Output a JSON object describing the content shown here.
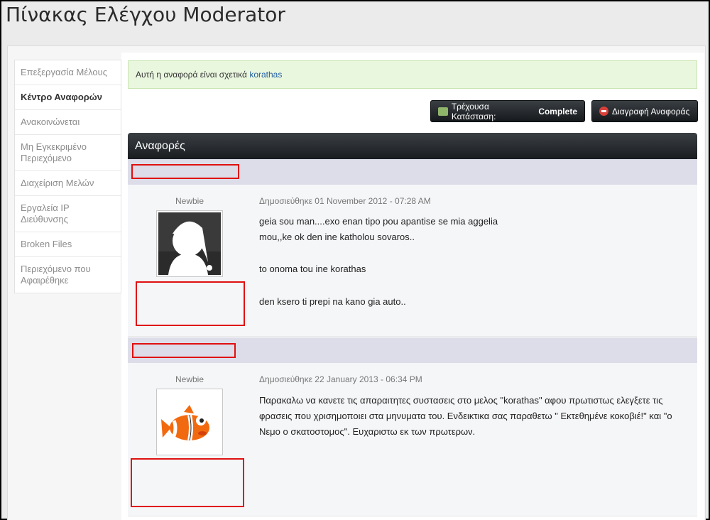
{
  "page": {
    "title": "Πίνακας Ελέγχου Moderator"
  },
  "sidebar": {
    "items": [
      {
        "label": "Επεξεργασία Μέλους"
      },
      {
        "label": "Κέντρο Αναφορών"
      },
      {
        "label": "Ανακοινώνεται"
      },
      {
        "label": "Μη Εγκεκριμένο Περιεχόμενο"
      },
      {
        "label": "Διαχείριση Μελών"
      },
      {
        "label": "Εργαλεία IP Διεύθυνσης"
      },
      {
        "label": "Broken Files"
      },
      {
        "label": "Περιεχόμενο που Αφαιρέθηκε"
      }
    ],
    "active_index": 1
  },
  "notice": {
    "text": "Αυτή η αναφορά είναι σχετικά",
    "link": "korathas"
  },
  "actions": {
    "status_prefix": "Τρέχουσα Κατάσταση:",
    "status_value": "Complete",
    "delete_label": "Διαγραφή Αναφοράς"
  },
  "section": {
    "title": "Αναφορές"
  },
  "posts": [
    {
      "user_title": "Newbie",
      "date": "Δημοσιεύθηκε 01 November 2012 - 07:28 AM",
      "lines": [
        "geia sou man....exo enan tipo pou apantise se mia aggelia mou,,ke ok den ine katholou sovaros..",
        "to onoma tou ine korathas",
        "den ksero ti prepi na kano gia auto.."
      ],
      "avatar": "silhouette-avatar"
    },
    {
      "user_title": "Newbie",
      "date": "Δημοσιεύθηκε 22 January 2013 - 06:34 PM",
      "lines": [
        "Παρακαλω να κανετε τις απαραιτητες συστασεις στο μελος \"korathas\" αφου πρωτιστως ελεγξετε τις φρασεις που χρισημοποιει στα μηνυματα του. Ενδεικτικα σας παραθετω \" Εκτεθημένε κοκοβιέ!\" και \"ο Νεμο ο σκατοστομος\". Ευχαριστω εκ των πρωτερων."
      ],
      "avatar": "clownfish-avatar"
    }
  ],
  "colors": {
    "redacted_box": "#e01010",
    "notice_bg": "#eaf7df",
    "link": "#245fa0"
  }
}
